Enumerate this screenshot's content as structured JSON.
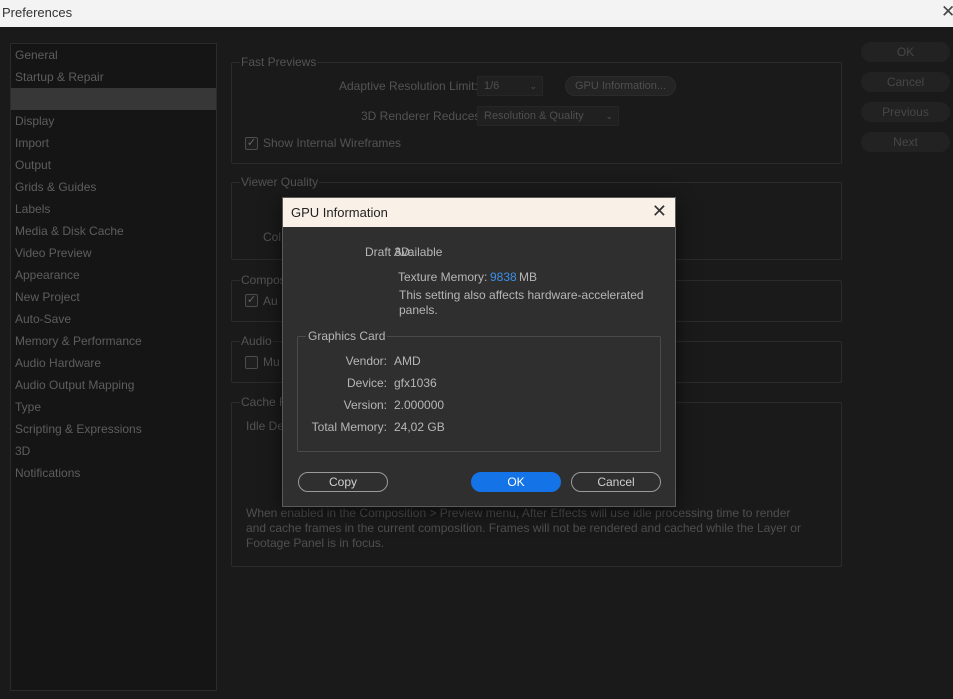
{
  "window": {
    "title": "Preferences",
    "close_glyph": "✕"
  },
  "sidebar": {
    "items": [
      "General",
      "Startup & Repair",
      "",
      "Display",
      "Import",
      "Output",
      "Grids & Guides",
      "Labels",
      "Media & Disk Cache",
      "Video Preview",
      "Appearance",
      "New Project",
      "Auto-Save",
      "Memory & Performance",
      "Audio Hardware",
      "Audio Output Mapping",
      "Type",
      "Scripting & Expressions",
      "3D",
      "Notifications"
    ],
    "selected_index": 2
  },
  "fast_previews": {
    "legend": "Fast Previews",
    "adaptive_label": "Adaptive Resolution Limit:",
    "adaptive_value": "1/6",
    "gpu_button": "GPU Information...",
    "renderer_label": "3D Renderer Reduces:",
    "renderer_value": "Resolution & Quality",
    "wireframes_label": "Show Internal Wireframes",
    "wireframes_checked": true
  },
  "viewer_quality": {
    "legend": "Viewer Quality",
    "partial_label": "Col"
  },
  "composition": {
    "legend": "Compos",
    "partial_label": "Au",
    "checked": true
  },
  "audio": {
    "legend": "Audio",
    "partial_label": "Mu",
    "checked": false
  },
  "cache": {
    "legend": "Cache F",
    "partial_label": "Idle De",
    "description": "When enabled in the Composition > Preview menu, After Effects will use idle processing time to render and cache frames in the current composition. Frames will not be rendered and cached while the Layer or Footage Panel is in focus."
  },
  "side_buttons": {
    "ok": "OK",
    "cancel": "Cancel",
    "previous": "Previous",
    "next": "Next"
  },
  "dialog": {
    "title": "GPU Information",
    "close_glyph": "✕",
    "draft3d_label": "Draft 3D:",
    "draft3d_value": "Available",
    "texture_label": "Texture Memory:",
    "texture_value": "9838",
    "texture_unit": "MB",
    "note_line1": "This setting also affects hardware-accelerated",
    "note_line2": "panels.",
    "graphics_card": {
      "legend": "Graphics Card",
      "vendor_label": "Vendor:",
      "vendor_value": "AMD",
      "device_label": "Device:",
      "device_value": "gfx1036",
      "version_label": "Version:",
      "version_value": "2.000000",
      "memory_label": "Total Memory:",
      "memory_value": "24,02 GB"
    },
    "copy_button": "Copy",
    "ok_button": "OK",
    "cancel_button": "Cancel",
    "accent_color": "#1473e6"
  }
}
